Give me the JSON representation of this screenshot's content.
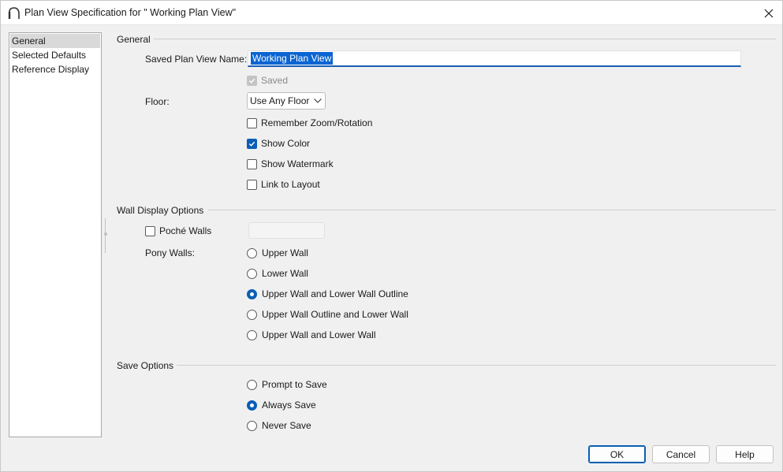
{
  "window": {
    "title": "Plan View Specification for \" Working Plan View\""
  },
  "nav": {
    "items": [
      {
        "label": "General",
        "selected": true
      },
      {
        "label": "Selected Defaults",
        "selected": false
      },
      {
        "label": "Reference Display",
        "selected": false
      }
    ]
  },
  "general": {
    "header": "General",
    "saved_name_label": "Saved Plan View Name:",
    "saved_name_value": "Working Plan View",
    "saved_label": "Saved",
    "saved_checked": true,
    "floor_label": "Floor:",
    "floor_value": "Use Any Floor",
    "remember_zoom_label": "Remember Zoom/Rotation",
    "remember_zoom_checked": false,
    "show_color_label": "Show Color",
    "show_color_checked": true,
    "show_watermark_label": "Show Watermark",
    "show_watermark_checked": false,
    "link_layout_label": "Link to Layout",
    "link_layout_checked": false
  },
  "wall_display": {
    "header": "Wall Display Options",
    "poche_label": "Poché Walls",
    "poche_checked": false,
    "pony_label": "Pony Walls:",
    "pony_options": [
      {
        "label": "Upper Wall",
        "checked": false
      },
      {
        "label": "Lower Wall",
        "checked": false
      },
      {
        "label": "Upper Wall and Lower Wall Outline",
        "checked": true
      },
      {
        "label": "Upper Wall Outline and Lower Wall",
        "checked": false
      },
      {
        "label": "Upper Wall and Lower Wall",
        "checked": false
      }
    ]
  },
  "save_options": {
    "header": "Save Options",
    "options": [
      {
        "label": "Prompt to Save",
        "checked": false
      },
      {
        "label": "Always Save",
        "checked": true
      },
      {
        "label": "Never Save",
        "checked": false
      }
    ]
  },
  "footer": {
    "ok_label": "OK",
    "cancel_label": "Cancel",
    "help_label": "Help"
  },
  "colors": {
    "accent": "#0a5fb4",
    "selection": "#0a64d2"
  }
}
